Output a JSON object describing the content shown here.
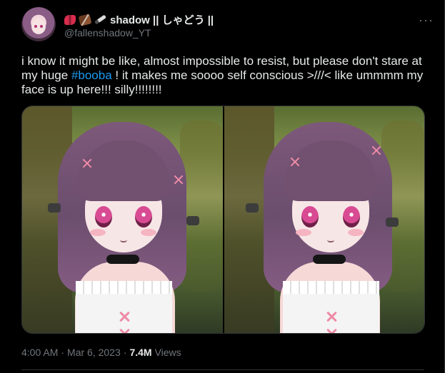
{
  "tweet": {
    "display_name": "shadow || しゃどう ||",
    "name_emojis": [
      "bow-icon",
      "chocolate-icon",
      "knife-icon"
    ],
    "handle": "@fallenshadow_YT",
    "more_label": "···",
    "text_before": "i know it might be like, almost impossible to resist, but please don't stare at my huge ",
    "hashtag": "#booba",
    "text_after": " ! it makes me soooo self conscious >///< like ummmm my face is up here!!! silly!!!!!!!!",
    "time": "4:00 AM",
    "date": "Mar 6, 2023",
    "separator": "·",
    "views_count": "7.4M",
    "views_label": "Views"
  },
  "colors": {
    "background": "#000000",
    "text": "#e7e9ea",
    "secondary_text": "#71767b",
    "link": "#1d9bf0"
  }
}
